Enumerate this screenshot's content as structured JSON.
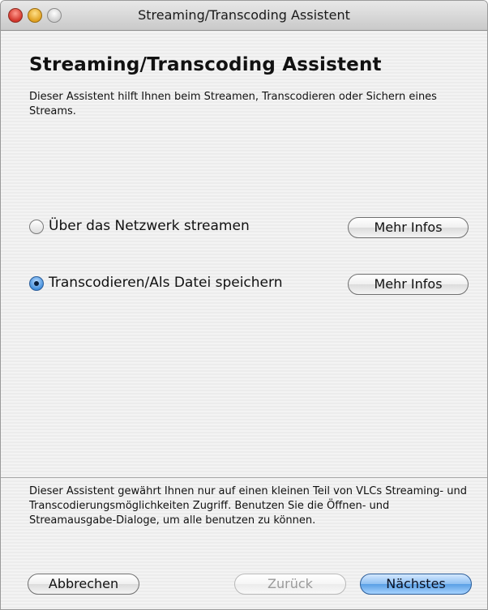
{
  "window": {
    "title": "Streaming/Transcoding Assistent"
  },
  "content": {
    "heading": "Streaming/Transcoding Assistent",
    "intro": "Dieser Assistent hilft Ihnen beim Streamen, Transcodieren oder Sichern eines Streams."
  },
  "options": [
    {
      "label": "Über das Netzwerk streamen",
      "checked": false,
      "info_label": "Mehr Infos"
    },
    {
      "label": "Transcodieren/Als Datei speichern",
      "checked": true,
      "info_label": "Mehr Infos"
    }
  ],
  "footer": {
    "note": "Dieser Assistent gewährt Ihnen nur auf einen kleinen Teil von VLCs Streaming- und Transcodierungsmöglichkeiten Zugriff. Benutzen Sie die Öffnen- und Streamausgabe-Dialoge, um alle benutzen zu können."
  },
  "buttons": {
    "cancel": "Abbrechen",
    "back": "Zurück",
    "next": "Nächstes"
  },
  "colors": {
    "default_button": "#5a9fe5",
    "close": "#d1342a",
    "minimize": "#e0a020"
  }
}
